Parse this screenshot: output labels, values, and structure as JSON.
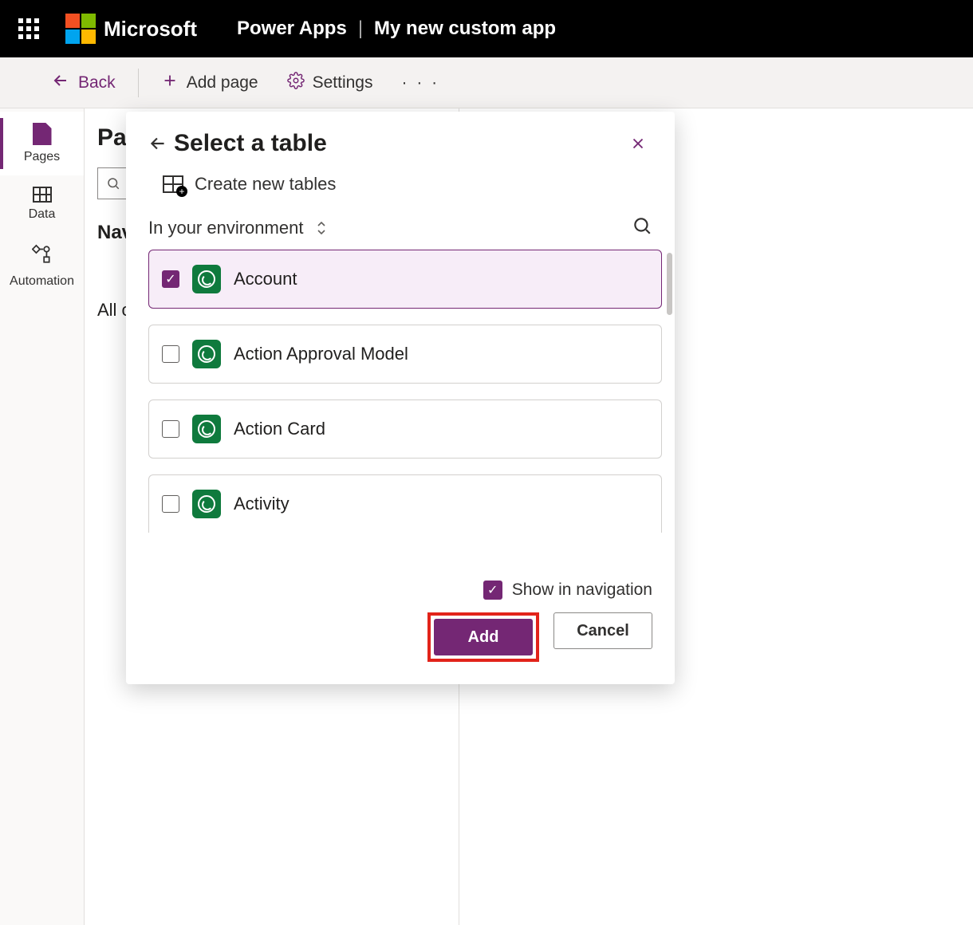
{
  "header": {
    "brand": "Microsoft",
    "product": "Power Apps",
    "app_title": "My new custom app"
  },
  "cmdbar": {
    "back": "Back",
    "add_page": "Add page",
    "settings": "Settings"
  },
  "rail": {
    "pages": "Pages",
    "data": "Data",
    "automation": "Automation"
  },
  "pages_panel": {
    "title": "Pages",
    "search_placeholder": "Search",
    "nav_heading": "Navigation",
    "all_other": "All other pages"
  },
  "dialog": {
    "title": "Select a table",
    "create_new": "Create new tables",
    "env_label": "In your environment",
    "tables": [
      {
        "label": "Account",
        "checked": true
      },
      {
        "label": "Action Approval Model",
        "checked": false
      },
      {
        "label": "Action Card",
        "checked": false
      },
      {
        "label": "Activity",
        "checked": false
      }
    ],
    "show_nav": "Show in navigation",
    "add": "Add",
    "cancel": "Cancel"
  }
}
